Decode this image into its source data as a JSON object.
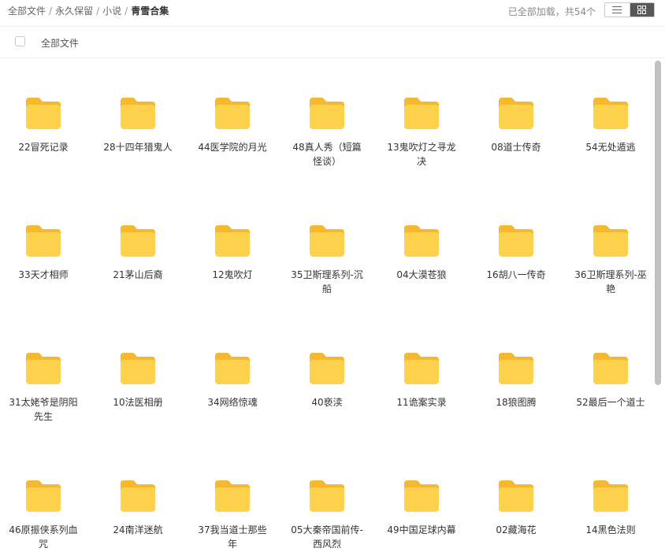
{
  "breadcrumb": {
    "items": [
      "全部文件",
      "永久保留",
      "小说"
    ],
    "separator": "/",
    "current": "青雪合集"
  },
  "status": {
    "text": "已全部加载，共54个"
  },
  "view_toggle": {
    "list_icon": "list-view-icon",
    "grid_icon": "grid-view-icon",
    "active": "grid"
  },
  "header": {
    "label": "全部文件"
  },
  "colors": {
    "folder_body": "#FFD24D",
    "folder_tab": "#F5B82E",
    "accent": "#585858"
  },
  "files": [
    {
      "name": "22冒死记录"
    },
    {
      "name": "28十四年猎鬼人"
    },
    {
      "name": "44医学院的月光"
    },
    {
      "name": "48真人秀（短篇怪谈）"
    },
    {
      "name": "13鬼吹灯之寻龙决"
    },
    {
      "name": "08道士传奇"
    },
    {
      "name": "54无处遁逃"
    },
    {
      "name": "33天才相师"
    },
    {
      "name": "21茅山后裔"
    },
    {
      "name": "12鬼吹灯"
    },
    {
      "name": "35卫斯理系列-沉船"
    },
    {
      "name": "04大漠苍狼"
    },
    {
      "name": "16胡八一传奇"
    },
    {
      "name": "36卫斯理系列-巫艳"
    },
    {
      "name": "31太姥爷是阴阳先生"
    },
    {
      "name": "10法医相册"
    },
    {
      "name": "34网络惊魂"
    },
    {
      "name": "40亵渎"
    },
    {
      "name": "11诡案实录"
    },
    {
      "name": "18狼图腾"
    },
    {
      "name": "52最后一个道士"
    },
    {
      "name": "46原振侠系列血咒"
    },
    {
      "name": "24南洋迷航"
    },
    {
      "name": "37我当道士那些年"
    },
    {
      "name": "05大秦帝国前传-西风烈"
    },
    {
      "name": "49中国足球内幕"
    },
    {
      "name": "02藏海花"
    },
    {
      "name": "14黑色法则"
    }
  ]
}
